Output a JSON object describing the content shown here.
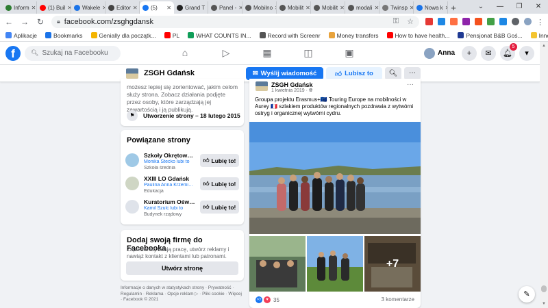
{
  "browser": {
    "tabs": [
      {
        "title": "Inform",
        "color": "#2e7d32"
      },
      {
        "title": "(1) Buil",
        "color": "#ff0000"
      },
      {
        "title": "Wakele",
        "color": "#1a73e8"
      },
      {
        "title": "Editor",
        "color": "#444444"
      },
      {
        "title": "(5) ",
        "color": "#1877f2",
        "active": true
      },
      {
        "title": "Grand T",
        "color": "#222222"
      },
      {
        "title": "Panel -",
        "color": "#555555"
      },
      {
        "title": "Mobilno",
        "color": "#555555"
      },
      {
        "title": "Mobilit",
        "color": "#555555"
      },
      {
        "title": "Mobilit",
        "color": "#555555"
      },
      {
        "title": "modali",
        "color": "#555555"
      },
      {
        "title": "Twinsp",
        "color": "#777777"
      },
      {
        "title": "Nowa k",
        "color": "#1a73e8"
      }
    ],
    "url": "facebook.com/zsghgdansk",
    "bookmarks": [
      {
        "label": "Aplikacje",
        "color": "#4285f4"
      },
      {
        "label": "Bookmarks",
        "color": "#1a73e8"
      },
      {
        "label": "Genially dla początk...",
        "color": "#f4b400"
      },
      {
        "label": "PL",
        "color": "#ff0000"
      },
      {
        "label": "WHAT COUNTS IN...",
        "color": "#0f9d58"
      },
      {
        "label": "Record with Screenr",
        "color": "#555555"
      },
      {
        "label": "Money transfers",
        "color": "#e8a33c"
      },
      {
        "label": "How to have health...",
        "color": "#ff0000"
      },
      {
        "label": "Pensjonat B&B Goś...",
        "color": "#1f3a93"
      }
    ],
    "bookmarks_other": "Inne zakładki"
  },
  "fb": {
    "logo": "f",
    "search_placeholder": "Szukaj na Facebooku",
    "profile_name": "Anna",
    "notifications": "5"
  },
  "page": {
    "name": "ZSGH Gdańsk",
    "send_message": "Wyślij wiadomość",
    "like": "Lubisz to"
  },
  "about": {
    "text": "możesz lepiej się zorientować, jakim celom służy strona. Zobacz działania podjęte przez osoby, które zarządzają jej zawartością i ją publikują.",
    "created": "Utworzenie strony – 18 lutego 2015"
  },
  "related": {
    "heading": "Powiązane strony",
    "items": [
      {
        "name": "Szkoły Okrętowe i ...",
        "liked_by": "Monika Stecko lubi to",
        "category": "Szkoła średnia",
        "button": "Lubię to!"
      },
      {
        "name": "XXIII LO Gdańsk",
        "liked_by": "Paulina Anna Krzemińsk...",
        "category": "Edukacja",
        "button": "Lubię to!"
      },
      {
        "name": "Kuratorium Oświat...",
        "liked_by": "Kamil Szulc lubi to",
        "category": "Budynek rządowy",
        "button": "Lubię to!"
      }
    ]
  },
  "promo": {
    "heading": "Dodaj swoją firmę do Facebooka",
    "text": "Zaprezentuj swoją pracę, utwórz reklamy i nawiąż kontakt z klientami lub patronami.",
    "button": "Utwórz stronę"
  },
  "footer": "Informacje o danych w statystykach strony · Prywatność · Regulamin · Reklama · Opcje reklam ▷ · Pliki cookie · Więcej · Facebook © 2021",
  "post": {
    "author": "ZSGH Gdańsk",
    "date": "1 kwietnia 2019 ·",
    "text": "Groupa projektu Erasmus+🇪🇺 Touring Europe na mobilności w Aurey 🇫🇷 szlakiem produktów regionalnych pozdrawia z wytwórni ostryg i organicznej wytwórni cydru.",
    "more_photos": "+7",
    "reactions_count": "35",
    "comments": "3 komentarze"
  }
}
